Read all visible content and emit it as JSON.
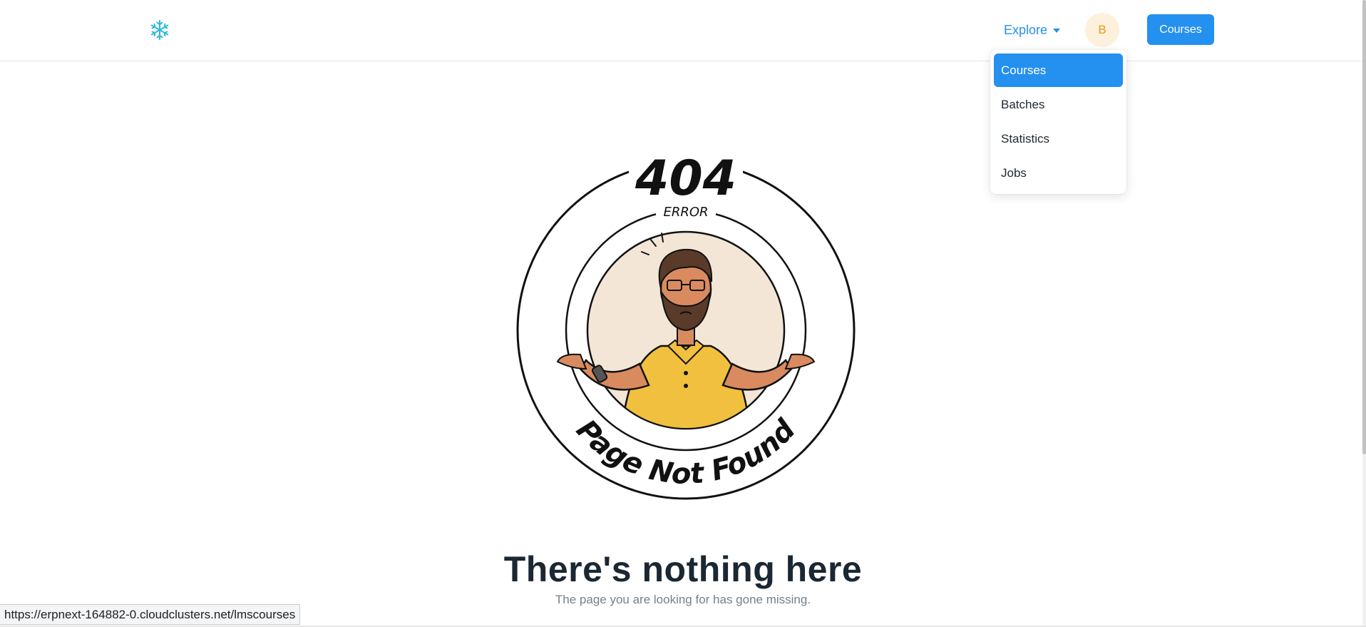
{
  "nav": {
    "logo_icon": "snowflake-icon",
    "explore_label": "Explore",
    "avatar_initial": "B",
    "courses_button_label": "Courses"
  },
  "dropdown": {
    "items": [
      {
        "label": "Courses",
        "active": true
      },
      {
        "label": "Batches",
        "active": false
      },
      {
        "label": "Statistics",
        "active": false
      },
      {
        "label": "Jobs",
        "active": false
      }
    ]
  },
  "error": {
    "code": "404",
    "error_word": "ERROR",
    "badge_text": "Page Not Found",
    "headline": "There's nothing here",
    "subtext": "The page you are looking for has gone missing."
  },
  "status_bar": {
    "url": "https://erpnext-164882-0.cloudclusters.net/lmscourses"
  },
  "colors": {
    "primary": "#2490ef",
    "avatar_bg": "#fdf1dd",
    "avatar_text": "#e79913",
    "shirt": "#f0c03e",
    "skin": "#d98b5f",
    "hair": "#5a3a29"
  }
}
